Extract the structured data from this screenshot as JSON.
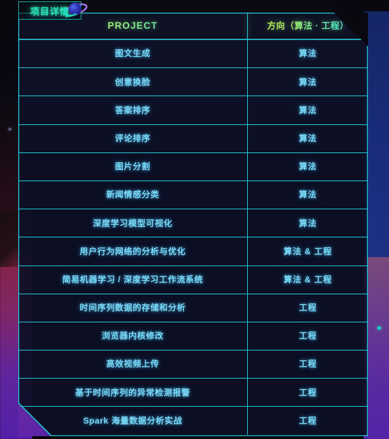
{
  "panel": {
    "title": "项目详情",
    "icon": "planet-icon"
  },
  "table": {
    "columns": [
      {
        "key": "project",
        "label": "PROJECT"
      },
      {
        "key": "direction",
        "label": "方向（算法 · 工程）"
      }
    ],
    "rows": [
      {
        "project": "图文生成",
        "direction": "算法"
      },
      {
        "project": "创意换脸",
        "direction": "算法"
      },
      {
        "project": "答案排序",
        "direction": "算法"
      },
      {
        "project": "评论排序",
        "direction": "算法"
      },
      {
        "project": "图片分割",
        "direction": "算法"
      },
      {
        "project": "新闻情感分类",
        "direction": "算法"
      },
      {
        "project": "深度学习模型可视化",
        "direction": "算法"
      },
      {
        "project": "用户行为网络的分析与优化",
        "direction": "算法 & 工程"
      },
      {
        "project": "简易机器学习 / 深度学习工作流系统",
        "direction": "算法 & 工程"
      },
      {
        "project": "时间序列数据的存储和分析",
        "direction": "工程"
      },
      {
        "project": "浏览器内核修改",
        "direction": "工程"
      },
      {
        "project": "高效视频上传",
        "direction": "工程"
      },
      {
        "project": "基于时间序列的异常检测报警",
        "direction": "工程"
      },
      {
        "project": "Spark 海量数据分析实战",
        "direction": "工程"
      }
    ]
  },
  "theme": {
    "background": "#08080f",
    "cell_background": "#0d1025",
    "border": "#22c6d8",
    "title_color": "#2ee6b8",
    "header_gradient_start": "#d3f23a",
    "header_gradient_end": "#2fe3d8",
    "body_text": "#79d9f5",
    "left_glow": "#b02e52",
    "right_glow_top": "#1a2e80",
    "right_glow_bottom": "#5626b0"
  }
}
